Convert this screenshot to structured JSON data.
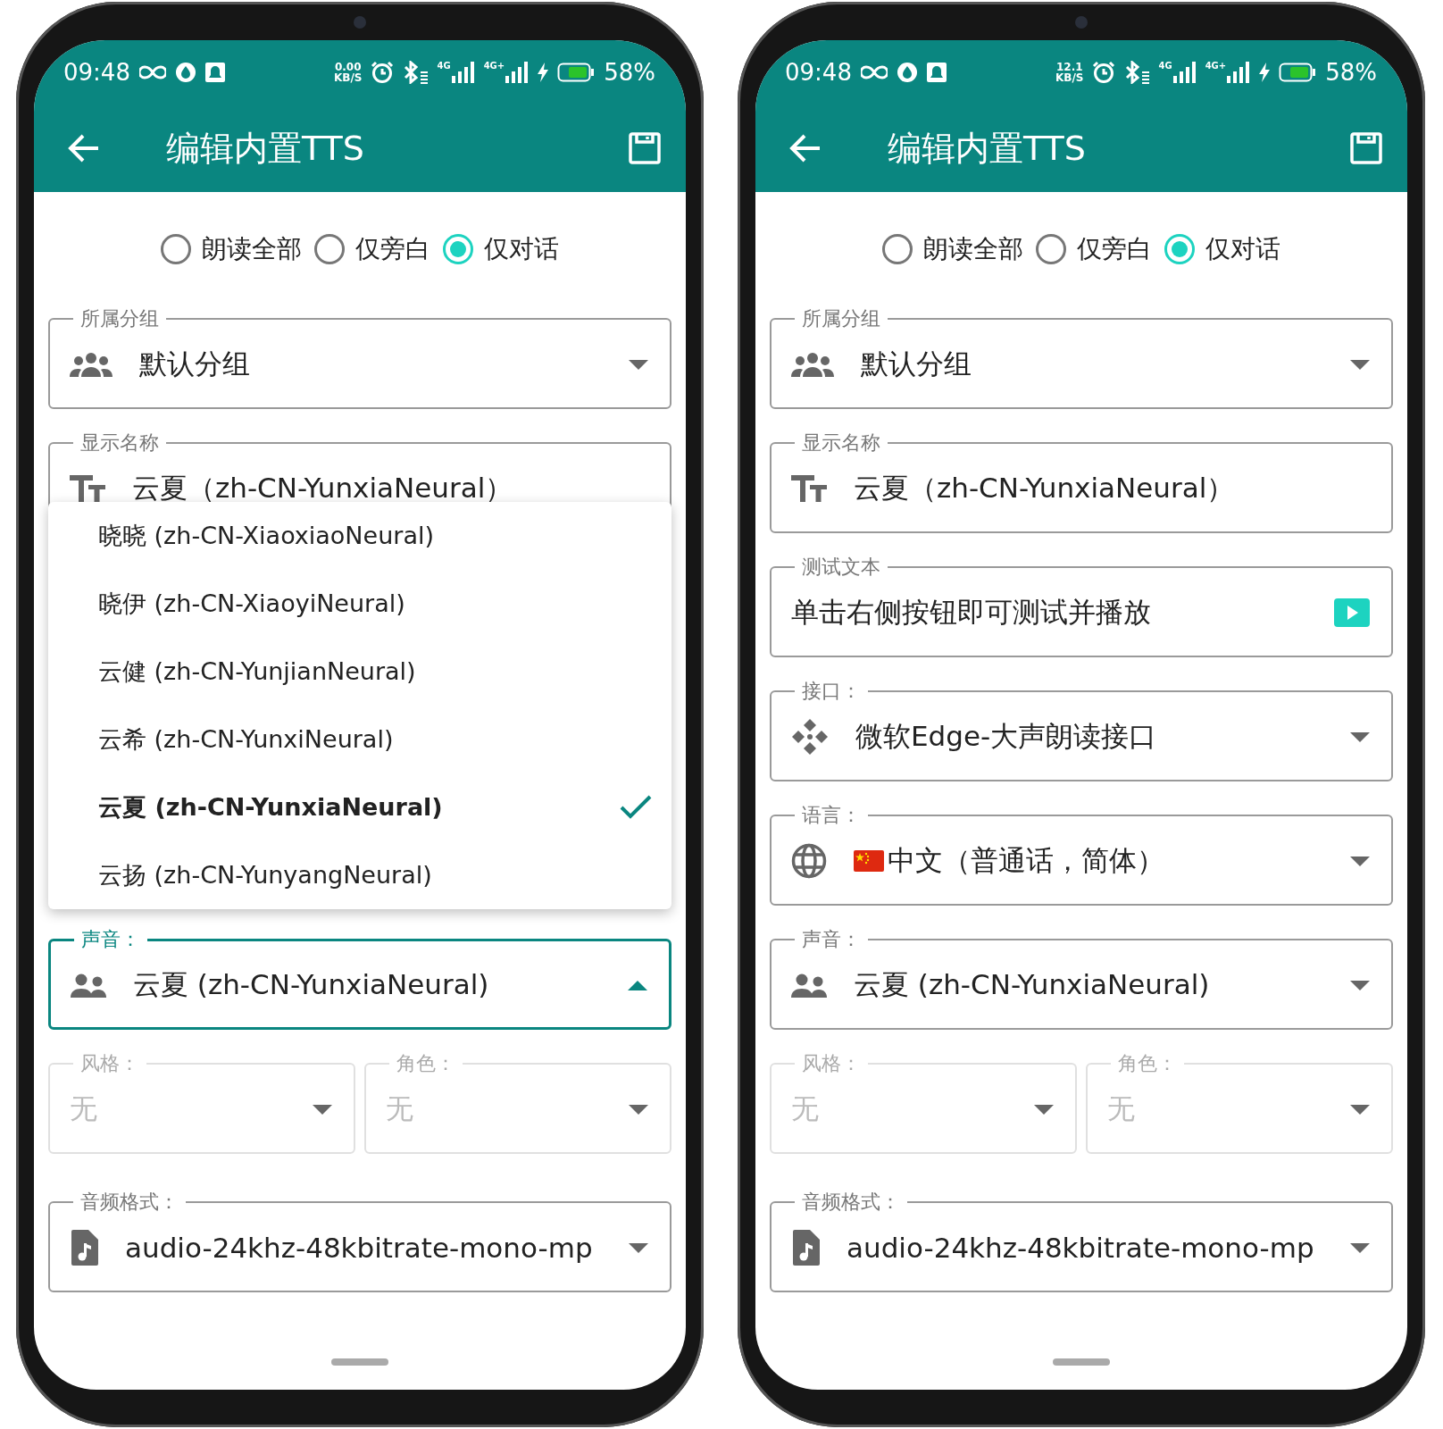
{
  "phones": [
    {
      "status_bar": {
        "time": "09:48",
        "speed": "0.00",
        "speed_unit": "KB/S",
        "network_labels": [
          "4G",
          "4G+"
        ],
        "battery": "58%"
      },
      "toolbar": {
        "title": "编辑内置TTS"
      },
      "read_modes": [
        {
          "label": "朗读全部",
          "selected": false
        },
        {
          "label": "仅旁白",
          "selected": false
        },
        {
          "label": "仅对话",
          "selected": true
        }
      ],
      "fields": [
        {
          "kind": "group",
          "label": "所属分组",
          "value": "默认分组"
        },
        {
          "kind": "display_name",
          "label": "显示名称",
          "value": "云夏（zh-CN-YunxiaNeural）"
        },
        {
          "kind": "voice",
          "label": "声音：",
          "value": "云夏 (zh-CN-YunxiaNeural)",
          "expanded": true
        },
        {
          "kind": "pair",
          "items": [
            {
              "label": "风格：",
              "value": "无",
              "disabled": true
            },
            {
              "label": "角色：",
              "value": "无",
              "disabled": true
            }
          ]
        },
        {
          "kind": "audio_format",
          "label": "音频格式：",
          "value": "audio-24khz-48kbitrate-mono-mp"
        }
      ],
      "voice_menu": {
        "items": [
          {
            "label": "晓晓 (zh-CN-XiaoxiaoNeural)",
            "selected": false
          },
          {
            "label": "晓伊 (zh-CN-XiaoyiNeural)",
            "selected": false
          },
          {
            "label": "云健 (zh-CN-YunjianNeural)",
            "selected": false
          },
          {
            "label": "云希 (zh-CN-YunxiNeural)",
            "selected": false
          },
          {
            "label": "云夏 (zh-CN-YunxiaNeural)",
            "selected": true
          },
          {
            "label": "云扬 (zh-CN-YunyangNeural)",
            "selected": false
          }
        ]
      }
    },
    {
      "status_bar": {
        "time": "09:48",
        "speed": "12.1",
        "speed_unit": "KB/S",
        "network_labels": [
          "4G",
          "4G+"
        ],
        "battery": "58%"
      },
      "toolbar": {
        "title": "编辑内置TTS"
      },
      "read_modes": [
        {
          "label": "朗读全部",
          "selected": false
        },
        {
          "label": "仅旁白",
          "selected": false
        },
        {
          "label": "仅对话",
          "selected": true
        }
      ],
      "fields": [
        {
          "kind": "group",
          "label": "所属分组",
          "value": "默认分组"
        },
        {
          "kind": "display_name",
          "label": "显示名称",
          "value": "云夏（zh-CN-YunxiaNeural）"
        },
        {
          "kind": "test_text",
          "label": "测试文本",
          "value": "单击右侧按钮即可测试并播放"
        },
        {
          "kind": "api",
          "label": "接口：",
          "value": "微软Edge-大声朗读接口"
        },
        {
          "kind": "language",
          "label": "语言：",
          "value": "中文（普通话，简体）"
        },
        {
          "kind": "voice",
          "label": "声音：",
          "value": "云夏 (zh-CN-YunxiaNeural)",
          "expanded": false
        },
        {
          "kind": "pair",
          "items": [
            {
              "label": "风格：",
              "value": "无",
              "disabled": true
            },
            {
              "label": "角色：",
              "value": "无",
              "disabled": true
            }
          ]
        },
        {
          "kind": "audio_format",
          "label": "音频格式：",
          "value": "audio-24khz-48kbitrate-mono-mp"
        }
      ]
    }
  ]
}
